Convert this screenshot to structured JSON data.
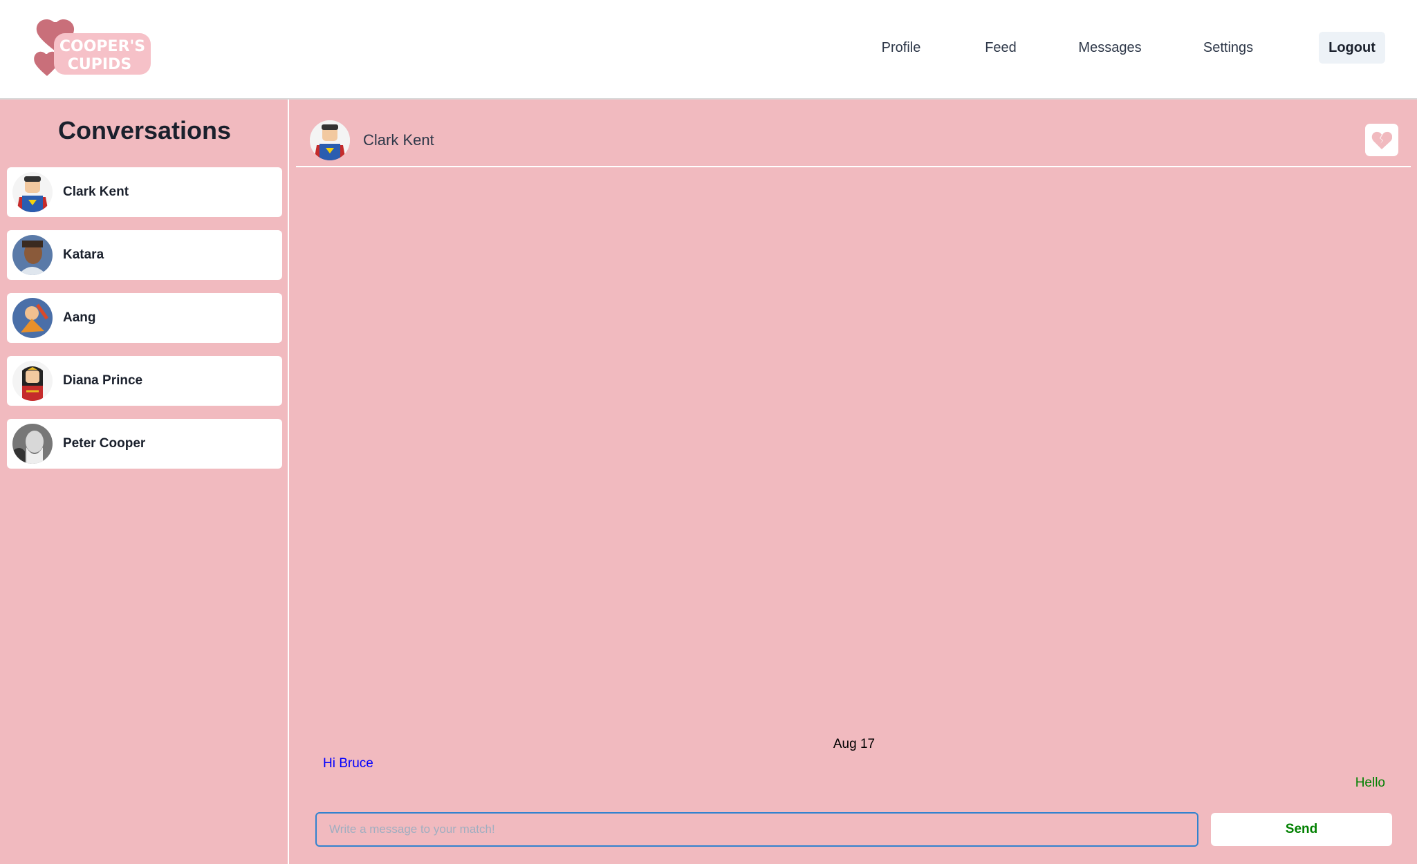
{
  "header": {
    "logo_text": "COOPER'S CUPIDS",
    "nav": [
      "Profile",
      "Feed",
      "Messages",
      "Settings"
    ],
    "logout_label": "Logout"
  },
  "sidebar": {
    "title": "Conversations",
    "items": [
      {
        "name": "Clark Kent",
        "avatar": "superman-lego"
      },
      {
        "name": "Katara",
        "avatar": "katara"
      },
      {
        "name": "Aang",
        "avatar": "aang"
      },
      {
        "name": "Diana Prince",
        "avatar": "wonder-woman-lego"
      },
      {
        "name": "Peter Cooper",
        "avatar": "peter-cooper-portrait"
      }
    ]
  },
  "chat": {
    "name": "Clark Kent",
    "unmatch_icon": "broken-heart-icon",
    "date": "Aug 17",
    "messages": [
      {
        "text": "Hi Bruce",
        "direction": "incoming",
        "color": "#0000ff"
      },
      {
        "text": "Hello",
        "direction": "outgoing",
        "color": "#008000"
      }
    ],
    "input_value": "",
    "input_placeholder": "Write a message to your match!",
    "send_label": "Send"
  },
  "colors": {
    "background": "#f1babf",
    "accent": "#c96f7a"
  }
}
